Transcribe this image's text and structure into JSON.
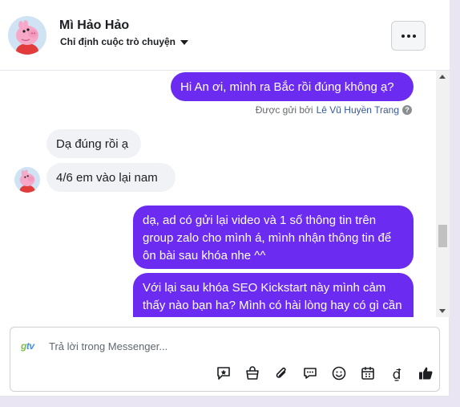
{
  "header": {
    "contact_name": "Mì Hảo Hảo",
    "assign_label": "Chỉ định cuộc trò chuyện"
  },
  "messages": [
    {
      "direction": "out",
      "text": "Hi An ơi, mình ra Bắc rồi đúng không ạ?"
    },
    {
      "direction": "in",
      "text": "Dạ đúng rồi ạ"
    },
    {
      "direction": "in",
      "text": "4/6 em vào lại nam"
    },
    {
      "direction": "out",
      "text": "dạ, ad có gửi lại video và 1 số thông tin trên group zalo cho mình á, mình nhận thông tin để ôn bài sau khóa nhe ^^"
    },
    {
      "direction": "out",
      "text": "Với lại sau khóa SEO Kickstart này mình cảm thấy nào bạn ha? Mình có hài lòng hay có gì cần ... khóa học không ạ?"
    }
  ],
  "sent_by": {
    "prefix": "Được gửi bởi",
    "name": "Lê Vũ Huyền Trang",
    "help_glyph": "?"
  },
  "composer": {
    "placeholder": "Trả lời trong Messenger...",
    "value": "",
    "brand_icon": "gtv-logo"
  },
  "toolbar_icons": [
    "saved-reply-icon",
    "shop-bag-icon",
    "attachment-icon",
    "chat-bubbles-icon",
    "emoji-icon",
    "calendar-icon",
    "currency-dong-icon",
    "thumbs-up-icon"
  ],
  "currency_symbol": "₫",
  "colors": {
    "outgoing_bubble": "#6c2bf0",
    "incoming_bubble": "#f0f2f5",
    "link": "#385898"
  }
}
